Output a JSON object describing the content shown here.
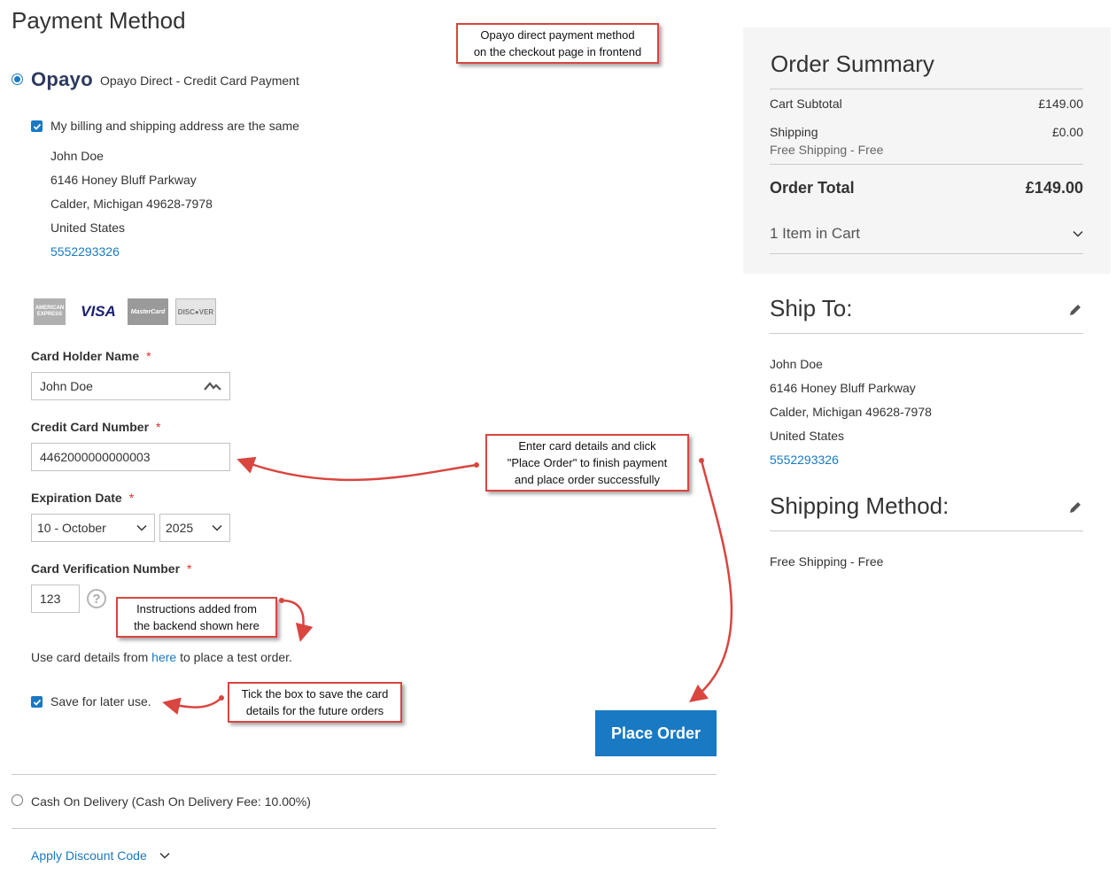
{
  "payment": {
    "title": "Payment Method",
    "opayo_logo": "Opayo",
    "opayo_label": "Opayo Direct - Credit Card Payment",
    "same_address_label": "My billing and shipping address are the same",
    "address": {
      "name": "John Doe",
      "street": "6146 Honey Bluff Parkway",
      "city": "Calder, Michigan 49628-7978",
      "country": "United States",
      "phone": "5552293326"
    },
    "cards": [
      "AMERICAN EXPRESS",
      "VISA",
      "MasterCard",
      "DISC●VER"
    ],
    "card_holder_label": "Card Holder Name",
    "card_holder_value": "John Doe",
    "card_number_label": "Credit Card Number",
    "card_number_value": "4462000000000003",
    "expiration_label": "Expiration Date",
    "exp_month": "10 - October",
    "exp_year": "2025",
    "cvv_label": "Card Verification Number",
    "cvv_value": "123",
    "required_mark": "*",
    "help_icon": "?",
    "instructions_pre": "Use card details from ",
    "instructions_link": "here",
    "instructions_post": " to place a test order.",
    "save_label": "Save for later use.",
    "place_order": "Place Order",
    "cod_label": "Cash On Delivery (Cash On Delivery Fee: 10.00%)",
    "discount_label": "Apply Discount Code"
  },
  "annotations": {
    "top": [
      "Opayo direct payment method",
      "on the checkout page in frontend"
    ],
    "card": [
      "Enter card details and click",
      "\"Place Order\" to finish payment",
      "and place order successfully"
    ],
    "instructions": [
      "Instructions added from",
      "the backend shown here"
    ],
    "save": [
      "Tick the box to save the card",
      "details for the future orders"
    ]
  },
  "summary": {
    "title": "Order Summary",
    "subtotal_label": "Cart Subtotal",
    "subtotal_value": "£149.00",
    "shipping_label": "Shipping",
    "shipping_value": "£0.00",
    "shipping_method": "Free Shipping - Free",
    "total_label": "Order Total",
    "total_value": "£149.00",
    "items_label": "1 Item in Cart"
  },
  "ship_to": {
    "title": "Ship To:",
    "name": "John Doe",
    "street": "6146 Honey Bluff Parkway",
    "city": "Calder, Michigan 49628-7978",
    "country": "United States",
    "phone": "5552293326"
  },
  "shipping_method": {
    "title": "Shipping Method:",
    "value": "Free Shipping - Free"
  },
  "colors": {
    "accent": "#1979c3",
    "annotation_border": "#d9453f",
    "required": "#e02b27"
  }
}
